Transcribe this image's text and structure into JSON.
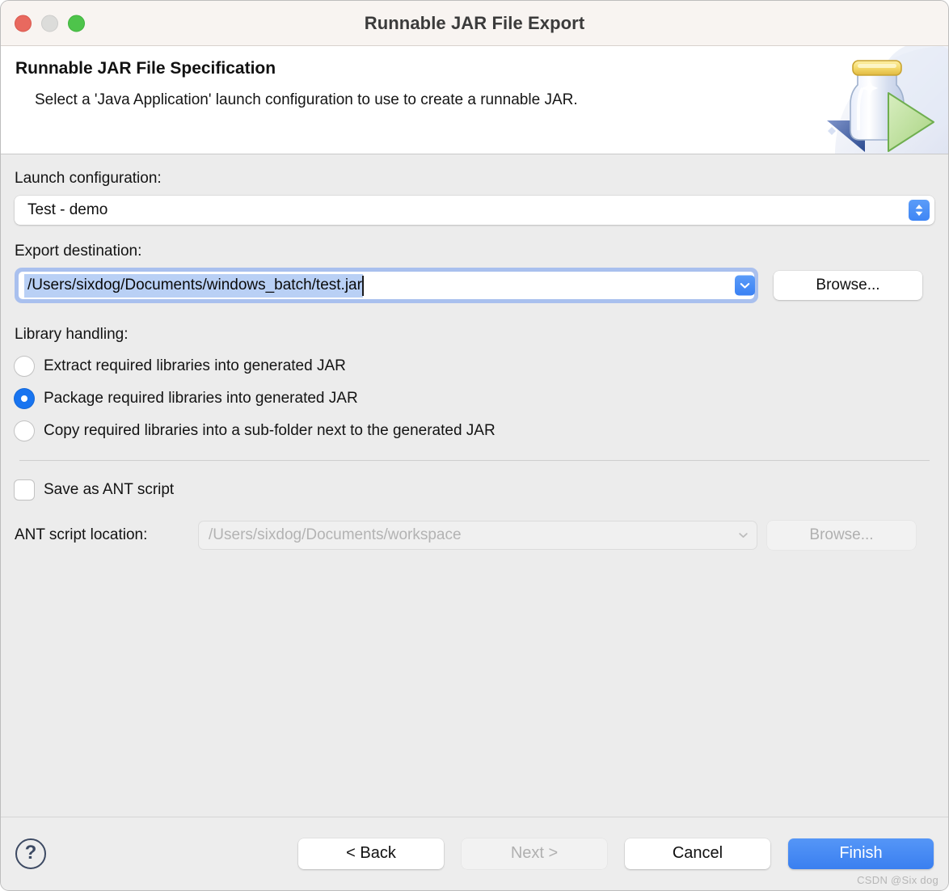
{
  "window": {
    "title": "Runnable JAR File Export",
    "traffic_lights": [
      {
        "name": "close",
        "color": "#e8695f"
      },
      {
        "name": "minimize",
        "color": "#dcdcda"
      },
      {
        "name": "maximize",
        "color": "#4ec44b"
      }
    ]
  },
  "header": {
    "title": "Runnable JAR File Specification",
    "description": "Select a 'Java Application' launch configuration to use to create a runnable JAR.",
    "icon": "jar-export-icon"
  },
  "form": {
    "launch_configuration": {
      "label": "Launch configuration:",
      "value": "Test - demo",
      "control": "popup-button"
    },
    "export_destination": {
      "label": "Export destination:",
      "value": "/Users/sixdog/Documents/windows_batch/test.jar",
      "selected": true,
      "focused": true,
      "browse_label": "Browse...",
      "browse_enabled": true
    },
    "library_handling": {
      "label": "Library handling:",
      "options": [
        {
          "label": "Extract required libraries into generated JAR",
          "checked": false
        },
        {
          "label": "Package required libraries into generated JAR",
          "checked": true
        },
        {
          "label": "Copy required libraries into a sub-folder next to the generated JAR",
          "checked": false
        }
      ]
    },
    "ant_script": {
      "checkbox_label": "Save as ANT script",
      "checked": false,
      "location_label": "ANT script location:",
      "location_value": "/Users/sixdog/Documents/workspace",
      "location_enabled": false,
      "browse_label": "Browse...",
      "browse_enabled": false
    }
  },
  "footer": {
    "help_glyph": "?",
    "back_label": "< Back",
    "next_label": "Next >",
    "next_enabled": false,
    "cancel_label": "Cancel",
    "finish_label": "Finish",
    "finish_accent": "#3a7ff0"
  },
  "watermark": "CSDN @Six dog"
}
